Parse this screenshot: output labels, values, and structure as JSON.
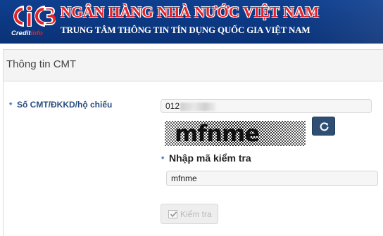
{
  "header": {
    "logo_text_1": "Credit",
    "logo_text_2": "info",
    "bank_name": "NGÂN HÀNG NHÀ NƯỚC VIỆT NAM",
    "subtitle": "TRUNG TÂM THÔNG TIN TÍN DỤNG QUỐC GIA VIỆT NAM"
  },
  "panel": {
    "title": "Thông tin CMT"
  },
  "form": {
    "id_label": "Số CMT/ĐKKD/hộ chiếu",
    "id_value_visible": "012",
    "captcha_text": "mfnme",
    "captcha_label": "Nhập mã kiểm tra",
    "captcha_input_value": "mfnme",
    "required_mark": "*",
    "submit_label": "Kiểm tra"
  },
  "icons": {
    "refresh": "refresh-icon",
    "check": "check-icon"
  },
  "colors": {
    "banner": "#0f3f8f",
    "brand_red": "#e2232a",
    "button_dark": "#2e4f73",
    "label_blue": "#2a4f7f"
  }
}
